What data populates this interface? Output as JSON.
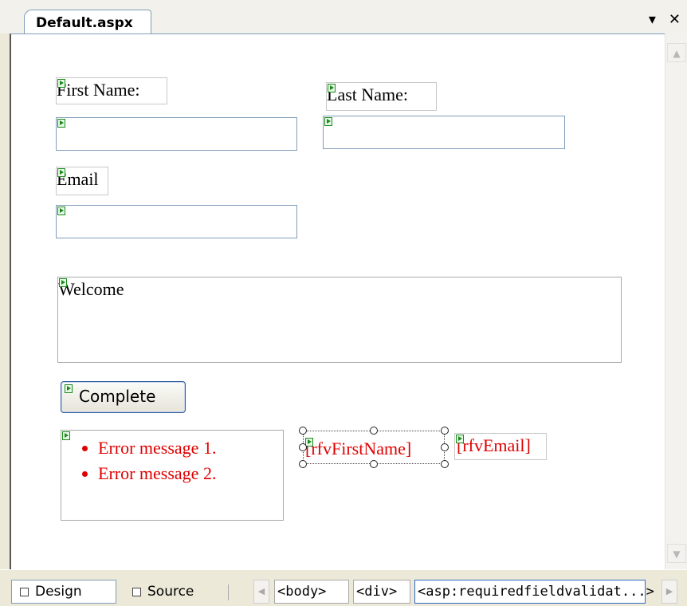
{
  "tab_strip": {
    "document_tab": "Default.aspx",
    "dropdown_glyph": "▾",
    "close_glyph": "✕"
  },
  "form": {
    "first_name_label": "First Name:",
    "last_name_label": "Last Name:",
    "email_label": "Email",
    "first_name_value": "",
    "last_name_value": "",
    "email_value": "",
    "welcome_text": "Welcome",
    "complete_button": "Complete",
    "validation_summary": [
      "Error message 1.",
      "Error message 2."
    ],
    "rfv_first_name": "[rfvFirstName]",
    "rfv_email": "[rfvEmail]"
  },
  "bottom_bar": {
    "design_tab": "Design",
    "source_tab": "Source",
    "breadcrumbs": [
      "<body>",
      "<div>",
      "<asp:requiredfieldvalidat...>"
    ],
    "active_view": "Design"
  },
  "icons": {
    "smart_tag": "smart-tag-icon",
    "scroll_up": "scroll-up-arrow-icon",
    "scroll_down": "scroll-down-arrow-icon",
    "nav_left": "nav-left-arrow-icon",
    "nav_right": "nav-right-arrow-icon"
  },
  "colors": {
    "validator_text": "#e00000",
    "glyph_green": "#1a8a1a",
    "textbox_border": "#7f9db9",
    "active_crumb_border": "#316ac5"
  }
}
